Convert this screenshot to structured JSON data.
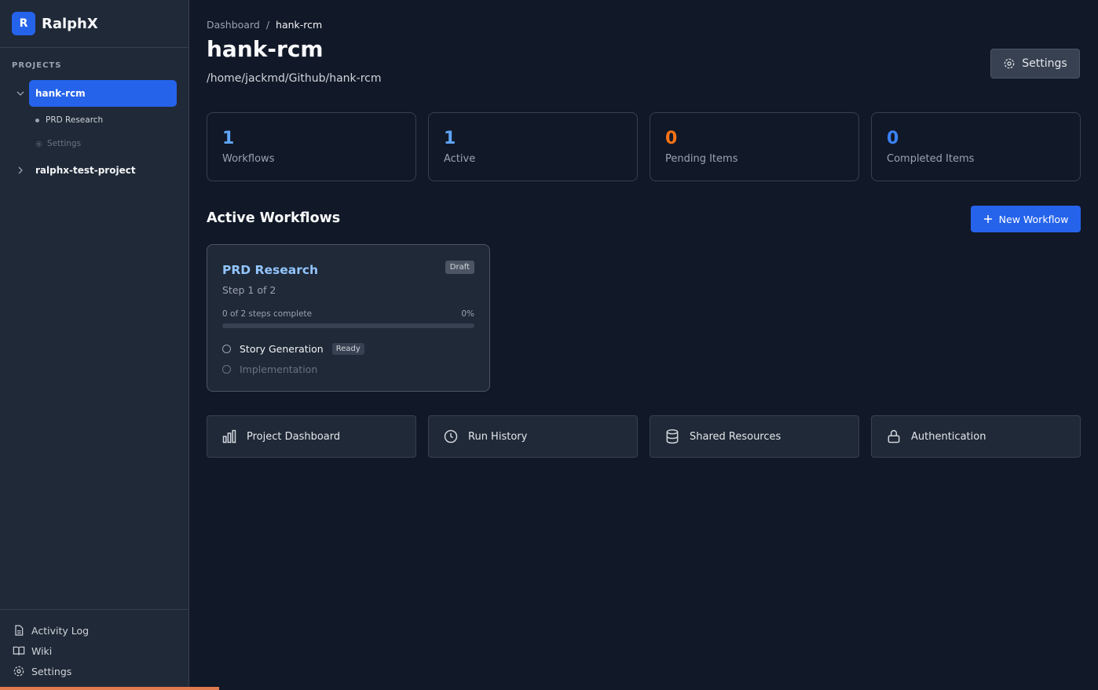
{
  "app": {
    "logo_letter": "R",
    "name": "RalphX"
  },
  "sidebar": {
    "projects_heading": "PROJECTS",
    "projects": [
      {
        "name": "hank-rcm",
        "expanded": true,
        "active": true
      },
      {
        "name": "ralphx-test-project",
        "expanded": false,
        "active": false
      }
    ],
    "sub_items": [
      {
        "label": "PRD Research",
        "icon": "dot-icon"
      },
      {
        "label": "Settings",
        "icon": "gear-icon"
      }
    ],
    "bottom": [
      {
        "label": "Activity Log",
        "icon": "file-text-icon"
      },
      {
        "label": "Wiki",
        "icon": "book-icon"
      },
      {
        "label": "Settings",
        "icon": "gear-icon"
      }
    ]
  },
  "header": {
    "breadcrumb": {
      "root": "Dashboard",
      "separator": "/",
      "current": "hank-rcm"
    },
    "title": "hank-rcm",
    "path": "/home/jackmd/Github/hank-rcm",
    "settings_label": "Settings"
  },
  "stats": [
    {
      "value": "1",
      "label": "Workflows",
      "color": "#60a5fa"
    },
    {
      "value": "1",
      "label": "Active",
      "color": "#60a5fa"
    },
    {
      "value": "0",
      "label": "Pending Items",
      "color": "#f97316"
    },
    {
      "value": "0",
      "label": "Completed Items",
      "color": "#3b82f6"
    }
  ],
  "active_workflows": {
    "heading": "Active Workflows",
    "new_button": "New Workflow",
    "workflow": {
      "title": "PRD Research",
      "badge": "Draft",
      "step_text": "Step 1 of 2",
      "progress_label": "0 of 2 steps complete",
      "progress_pct": "0%",
      "progress_fraction": 0,
      "steps": [
        {
          "label": "Story Generation",
          "badge": "Ready",
          "color": "#f3f4f6"
        },
        {
          "label": "Implementation",
          "badge": "",
          "color": "#6b7280"
        }
      ]
    }
  },
  "quick_links": [
    {
      "label": "Project Dashboard",
      "icon": "bar-chart-icon"
    },
    {
      "label": "Run History",
      "icon": "clock-icon"
    },
    {
      "label": "Shared Resources",
      "icon": "database-icon"
    },
    {
      "label": "Authentication",
      "icon": "lock-icon"
    }
  ],
  "colors": {
    "accent": "#2563eb",
    "background": "#111827",
    "sidebar": "#1f2937"
  }
}
